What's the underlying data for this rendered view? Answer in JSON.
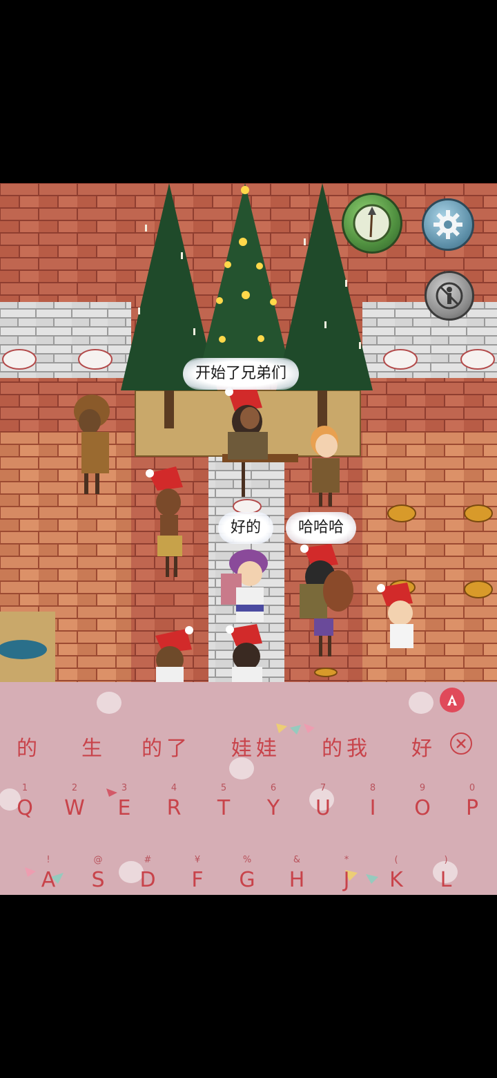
{
  "speech_bubbles": {
    "leader": "开始了兄弟们",
    "reply_ok": "好的",
    "reply_laugh": "哈哈哈"
  },
  "hud": {
    "compass_icon": "compass-spear-icon",
    "settings_icon": "gear-icon",
    "hide_icon": "no-person-icon"
  },
  "keyboard": {
    "mode_icon": "letter-a-icon",
    "candidates": [
      "的",
      "生",
      "的了",
      "娃娃",
      "的我",
      "好"
    ],
    "delete_icon": "circle-x-icon",
    "row1": [
      {
        "sub": "1",
        "key": "Q"
      },
      {
        "sub": "2",
        "key": "W"
      },
      {
        "sub": "3",
        "key": "E"
      },
      {
        "sub": "4",
        "key": "R"
      },
      {
        "sub": "5",
        "key": "T"
      },
      {
        "sub": "6",
        "key": "Y"
      },
      {
        "sub": "7",
        "key": "U"
      },
      {
        "sub": "8",
        "key": "I"
      },
      {
        "sub": "9",
        "key": "O"
      },
      {
        "sub": "0",
        "key": "P"
      }
    ],
    "row2": [
      {
        "sub": "!",
        "key": "A"
      },
      {
        "sub": "@",
        "key": "S"
      },
      {
        "sub": "#",
        "key": "D"
      },
      {
        "sub": "¥",
        "key": "F"
      },
      {
        "sub": "%",
        "key": "G"
      },
      {
        "sub": "&",
        "key": "H"
      },
      {
        "sub": "*",
        "key": "J"
      },
      {
        "sub": "(",
        "key": "K"
      },
      {
        "sub": ")",
        "key": "L"
      }
    ]
  },
  "colors": {
    "brick": "#b55a45",
    "keyboard_bg": "#d6aeb5",
    "key_text": "#c8434a",
    "compass_green": "#5a9a4a",
    "settings_blue": "#5d8fa8"
  }
}
